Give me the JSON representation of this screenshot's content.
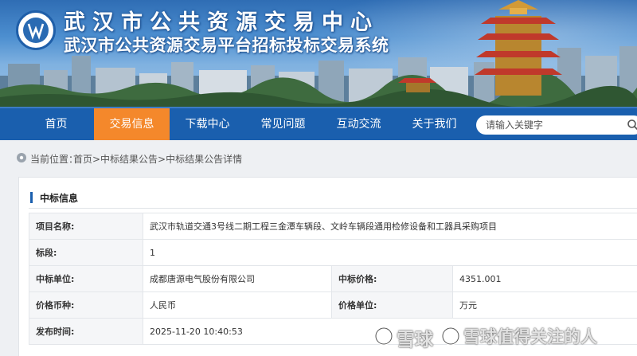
{
  "header": {
    "title": "武汉市公共资源交易中心",
    "subtitle": "武汉市公共资源交易平台招标投标交易系统"
  },
  "nav": {
    "items": [
      {
        "label": "首页"
      },
      {
        "label": "交易信息",
        "active": true
      },
      {
        "label": "下载中心"
      },
      {
        "label": "常见问题"
      },
      {
        "label": "互动交流"
      },
      {
        "label": "关于我们"
      }
    ],
    "search_placeholder": "请输入关键字",
    "search_icon": "search-icon"
  },
  "breadcrumb": {
    "prefix": "当前位置：",
    "path": "首页>中标结果公告>中标结果公告详情"
  },
  "section": {
    "title": "中标信息"
  },
  "details": {
    "project_name_label": "项目名称:",
    "project_name": "武汉市轨道交通3号线二期工程三金潭车辆段、文岭车辆段通用检修设备和工器具采购项目",
    "section_label": "标段:",
    "section_value": "1",
    "winner_label": "中标单位:",
    "winner_value": "成都唐源电气股份有限公司",
    "price_label": "中标价格:",
    "price_value": "4351.001",
    "currency_label": "价格币种:",
    "currency_value": "人民币",
    "unit_label": "价格单位:",
    "unit_value": "万元",
    "publish_time_label": "发布时间:",
    "publish_time_value": "2025-11-20 10:40:53"
  },
  "watermark": {
    "left": "雪球",
    "right": "雪球值得关注的人"
  },
  "colors": {
    "nav_bg": "#1a5fae",
    "nav_active": "#f4882b",
    "accent": "#1a5fae"
  }
}
